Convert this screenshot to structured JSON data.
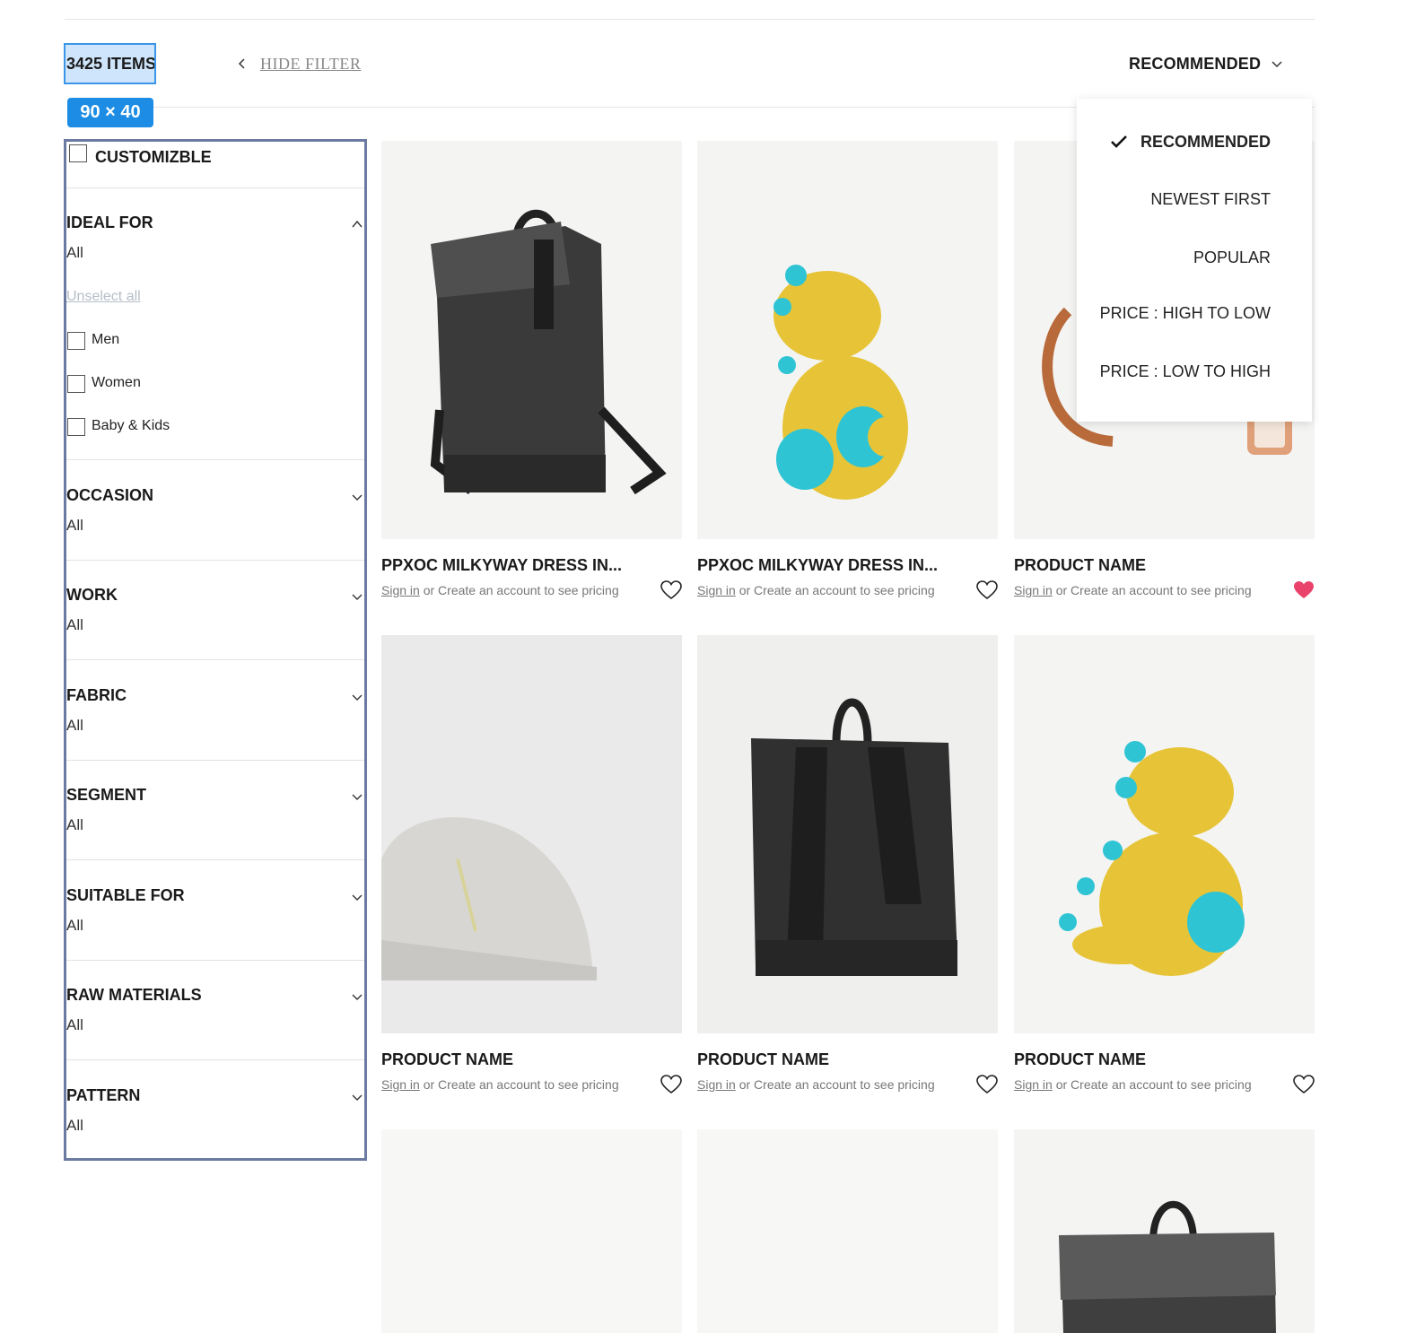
{
  "toolbar": {
    "items_count": "3425 ITEMS",
    "size_badge": "90 × 40",
    "hide_filter_label": "HIDE FILTER",
    "sort_label": "RECOMMENDED"
  },
  "sort_menu": {
    "options": [
      {
        "label": "RECOMMENDED",
        "selected": true
      },
      {
        "label": "NEWEST FIRST",
        "selected": false
      },
      {
        "label": "POPULAR",
        "selected": false
      },
      {
        "label": "PRICE : HIGH TO LOW",
        "selected": false
      },
      {
        "label": "PRICE : LOW TO HIGH",
        "selected": false
      }
    ]
  },
  "filters": {
    "customizable_label": "CUSTOMIZBLE",
    "unselect_all": "Unselect all",
    "groups": [
      {
        "title": "IDEAL FOR",
        "value": "All",
        "expanded": true,
        "options": [
          "Men",
          "Women",
          "Baby & Kids"
        ]
      },
      {
        "title": "OCCASION",
        "value": "All",
        "expanded": false
      },
      {
        "title": "WORK",
        "value": "All",
        "expanded": false
      },
      {
        "title": "FABRIC",
        "value": "All",
        "expanded": false
      },
      {
        "title": "SEGMENT",
        "value": "All",
        "expanded": false
      },
      {
        "title": "SUITABLE FOR",
        "value": "All",
        "expanded": false
      },
      {
        "title": "RAW MATERIALS",
        "value": "All",
        "expanded": false
      },
      {
        "title": "PATTERN",
        "value": "All",
        "expanded": false
      }
    ]
  },
  "pricing": {
    "signin_link": "Sign in",
    "rest": " or Create an account to see pricing"
  },
  "products": [
    {
      "name": "PPXOC MILKYWAY DRESS IN...",
      "image": "backpack-icon",
      "favorited": false
    },
    {
      "name": "PPXOC MILKYWAY DRESS IN...",
      "image": "toy-dinosaur-icon",
      "favorited": false
    },
    {
      "name": "PRODUCT NAME",
      "image": "bag-strap-icon",
      "favorited": true
    },
    {
      "name": "PRODUCT NAME",
      "image": "cap-icon",
      "favorited": false
    },
    {
      "name": "PRODUCT NAME",
      "image": "backpack-back-icon",
      "favorited": false
    },
    {
      "name": "PRODUCT NAME",
      "image": "toy-dinosaur-icon",
      "favorited": false
    },
    {
      "image": "blank-image"
    },
    {
      "image": "blank-image"
    },
    {
      "image": "backpack-icon"
    }
  ],
  "colors": {
    "accent_blue": "#1c8ce4",
    "selection_fill": "#cfe5fb",
    "filter_border": "#6b7aa3",
    "heart_active": "#e9436b",
    "text": "#1a1a1a",
    "muted": "#777777"
  }
}
